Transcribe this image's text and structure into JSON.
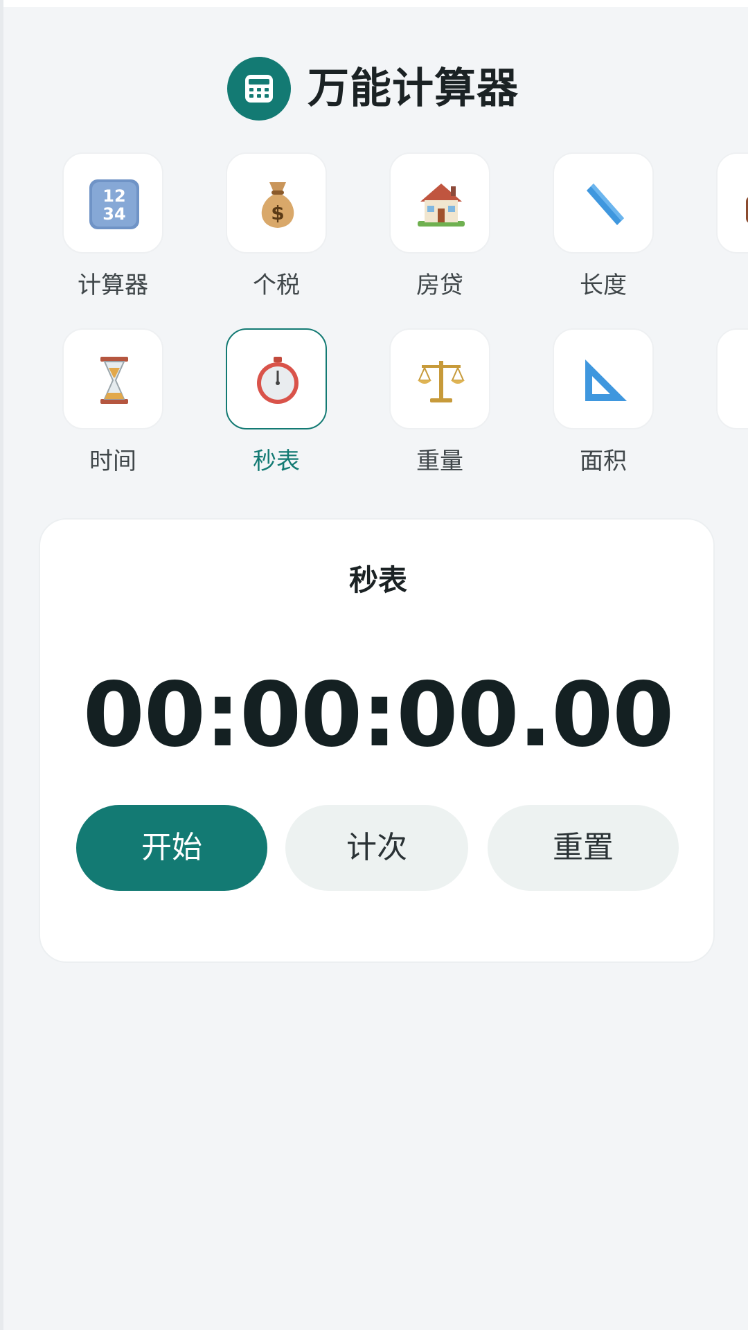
{
  "app": {
    "title": "万能计算器",
    "accent_color": "#137a73",
    "logo_icon": "calculator-icon"
  },
  "tools": [
    {
      "label": "计算器",
      "icon": "keycap-digits-icon"
    },
    {
      "label": "个税",
      "icon": "money-bag-icon"
    },
    {
      "label": "房贷",
      "icon": "house-icon"
    },
    {
      "label": "长度",
      "icon": "ruler-icon"
    },
    {
      "label": "",
      "icon": "briefcase-icon"
    },
    {
      "label": "时间",
      "icon": "hourglass-icon"
    },
    {
      "label": "秒表",
      "icon": "stopwatch-icon",
      "active": true
    },
    {
      "label": "重量",
      "icon": "balance-scale-icon"
    },
    {
      "label": "面积",
      "icon": "triangle-ruler-icon"
    },
    {
      "label": "",
      "icon": "tool-icon"
    }
  ],
  "stopwatch": {
    "title": "秒表",
    "time": "00:00:00.00",
    "start_label": "开始",
    "lap_label": "计次",
    "reset_label": "重置"
  }
}
